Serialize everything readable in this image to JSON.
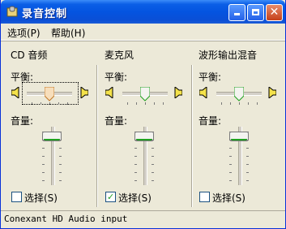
{
  "window": {
    "title": "录音控制"
  },
  "menu": [
    {
      "label": "选项(P)"
    },
    {
      "label": "帮助(H)"
    }
  ],
  "channels": [
    {
      "title": "CD 音频",
      "balance_label": "平衡:",
      "volume_label": "音量:",
      "select_label": "选择(S)",
      "selected": false,
      "balance": 0.5,
      "volume": 0.9
    },
    {
      "title": "麦克风",
      "balance_label": "平衡:",
      "volume_label": "音量:",
      "select_label": "选择(S)",
      "selected": true,
      "balance": 0.5,
      "volume": 0.9
    },
    {
      "title": "波形输出混音",
      "balance_label": "平衡:",
      "volume_label": "音量:",
      "select_label": "选择(S)",
      "selected": false,
      "balance": 0.5,
      "volume": 0.9
    }
  ],
  "status": {
    "text": "Conexant HD Audio input"
  },
  "colors": {
    "titlebar": "#0454E0",
    "window_bg": "#ECE9D8",
    "thumb_green": "#21A121"
  },
  "icons": {
    "app": "microphone-icon",
    "speaker_left": "speaker-left-icon",
    "speaker_right": "speaker-right-icon"
  }
}
